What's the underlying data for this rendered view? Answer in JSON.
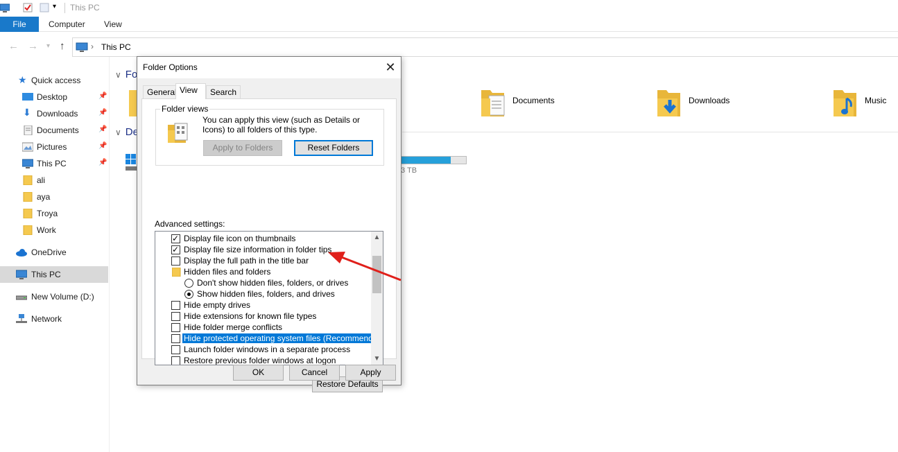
{
  "window": {
    "title": "This PC"
  },
  "ribbon": {
    "file": "File",
    "computer": "Computer",
    "view": "View"
  },
  "address": {
    "crumb": "This PC"
  },
  "sidebar": {
    "quick_access": "Quick access",
    "items": [
      {
        "label": "Desktop",
        "pinned": true
      },
      {
        "label": "Downloads",
        "pinned": true
      },
      {
        "label": "Documents",
        "pinned": true
      },
      {
        "label": "Pictures",
        "pinned": true
      },
      {
        "label": "This PC",
        "pinned": true
      },
      {
        "label": "ali",
        "pinned": false
      },
      {
        "label": "aya",
        "pinned": false
      },
      {
        "label": "Troya",
        "pinned": false
      },
      {
        "label": "Work",
        "pinned": false
      }
    ],
    "onedrive": "OneDrive",
    "this_pc": "This PC",
    "new_volume": "New Volume (D:)",
    "network": "Network"
  },
  "content": {
    "folders_header": "Fo",
    "devices_header": "De",
    "folders": [
      {
        "label": "Documents"
      },
      {
        "label": "Downloads"
      },
      {
        "label": "Music"
      }
    ],
    "drive_size_text": "3 TB",
    "drive_fill_percent": 76
  },
  "dialog": {
    "title": "Folder Options",
    "close_glyph": "✕",
    "tabs": {
      "general": "General",
      "view": "View",
      "search": "Search"
    },
    "folder_views": {
      "legend": "Folder views",
      "description": "You can apply this view (such as Details or Icons) to all folders of this type.",
      "apply_button": "Apply to Folders",
      "reset_button": "Reset Folders"
    },
    "advanced_label": "Advanced settings:",
    "settings": [
      {
        "label": "Display file icon on thumbnails",
        "checked": "✓"
      },
      {
        "label": "Display file size information in folder tips",
        "checked": "✓"
      },
      {
        "label": "Display the full path in the title bar",
        "checked": ""
      },
      {
        "label": "Hidden files and folders"
      },
      {
        "label": "Don't show hidden files, folders, or drives",
        "selected": false
      },
      {
        "label": "Show hidden files, folders, and drives",
        "selected": true
      },
      {
        "label": "Hide empty drives",
        "checked": ""
      },
      {
        "label": "Hide extensions for known file types",
        "checked": ""
      },
      {
        "label": "Hide folder merge conflicts",
        "checked": ""
      },
      {
        "label": "Hide protected operating system files (Recommended)",
        "checked": ""
      },
      {
        "label": "Launch folder windows in a separate process",
        "checked": ""
      },
      {
        "label": "Restore previous folder windows at logon",
        "checked": ""
      }
    ],
    "restore_defaults": "Restore Defaults",
    "ok": "OK",
    "cancel": "Cancel",
    "apply": "Apply"
  },
  "colors": {
    "accent": "#0078d7",
    "file_tab": "#1979ca",
    "annotation_arrow": "#e0201b",
    "folder_yellow": "#f5c94f"
  }
}
